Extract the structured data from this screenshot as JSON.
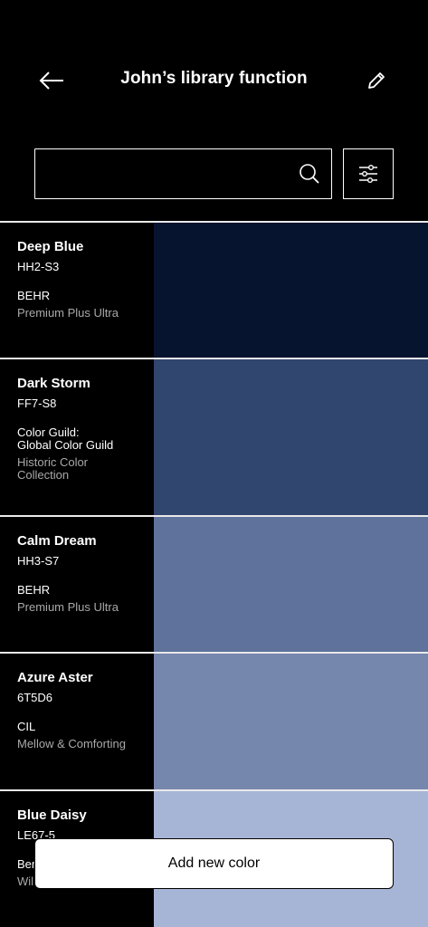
{
  "header": {
    "title": "John’s library function",
    "back_icon": "arrow-left-icon",
    "edit_icon": "pencil-icon"
  },
  "search": {
    "value": "",
    "placeholder": "",
    "icon": "search-icon",
    "filter_icon": "sliders-icon"
  },
  "colors": [
    {
      "name": "Deep Blue",
      "code": "HH2-S3",
      "brand": "BEHR",
      "collection": "Premium Plus Ultra",
      "hex": "#071430"
    },
    {
      "name": "Dark Storm",
      "code": "FF7-S8",
      "brand": "Color Guild:\nGlobal Color Guild",
      "collection": "Historic Color\nCollection",
      "hex": "#31466e"
    },
    {
      "name": "Calm Dream",
      "code": "HH3-S7",
      "brand": "BEHR",
      "collection": "Premium Plus Ultra",
      "hex": "#5e729b"
    },
    {
      "name": "Azure Aster",
      "code": "6T5D6",
      "brand": "CIL",
      "collection": "Mellow & Comforting",
      "hex": "#7687ae"
    },
    {
      "name": "Blue Daisy",
      "code": "LE67-5",
      "brand": "Ber",
      "collection": "Wil",
      "hex": "#a6b5d6"
    }
  ],
  "footer": {
    "add_label": "Add new color"
  }
}
